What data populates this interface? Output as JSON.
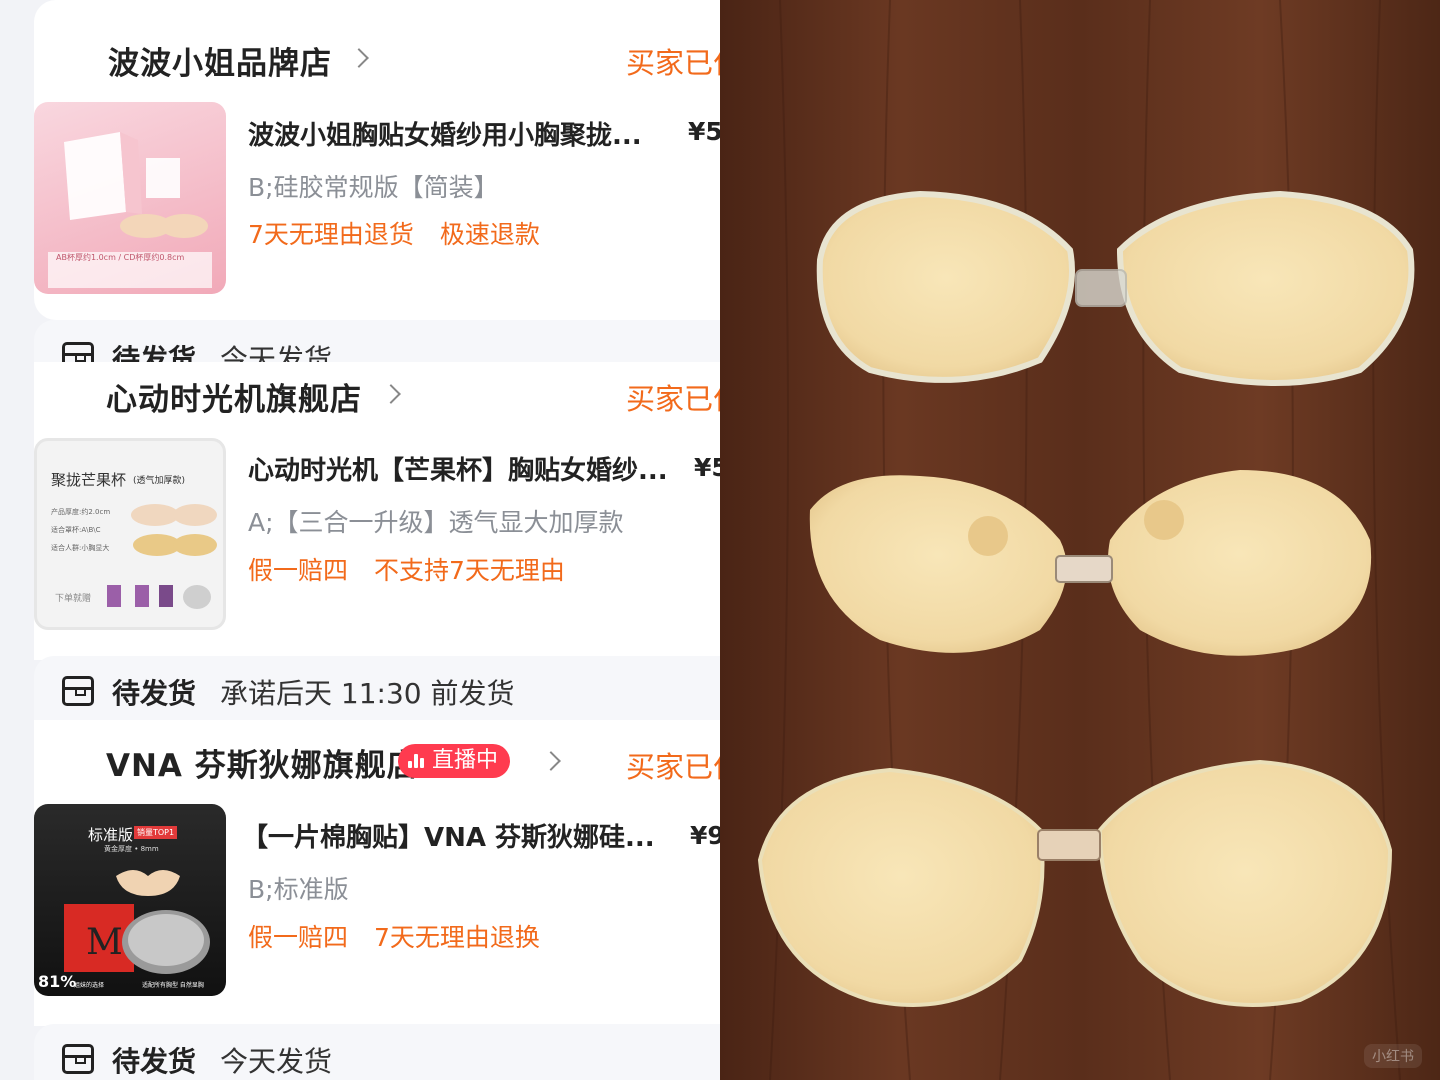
{
  "shops": [
    {
      "name": "波波小姐品牌店",
      "status": "买家已付款",
      "product_title": "波波小姐胸贴女婚纱用小胸聚拢...",
      "price": "¥5",
      "variant": "B;硅胶常规版【简装】",
      "tags": [
        "7天无理由退货",
        "极速退款"
      ],
      "thumb_text": "AB杯厚约1.0cm / CD杯厚约0.8cm",
      "strip_status": "待发货",
      "strip_ship": "今天发货"
    },
    {
      "name": "心动时光机旗舰店",
      "status": "买家已付款",
      "product_title": "心动时光机【芒果杯】胸贴女婚纱...",
      "price": "¥5",
      "variant": "A;【三合一升级】透气显大加厚款",
      "tags": [
        "假一赔四",
        "不支持7天无理由"
      ],
      "thumb_title": "聚拢芒果杯",
      "thumb_subtitle": "(透气加厚款)",
      "thumb_lines": [
        "产品厚度:约2.0cm",
        "适合罩杯:A\\B\\C",
        "适合人群:小胸显大"
      ],
      "thumb_footer": "下单就赠",
      "strip_status": "待发货",
      "strip_ship": "承诺后天 11:30 前发货"
    },
    {
      "name": "VNA 芬斯狄娜旗舰店",
      "live_label": "直播中",
      "status": "买家已付款",
      "product_title": "【一片棉胸贴】VNA 芬斯狄娜硅...",
      "price": "¥9",
      "variant": "B;标准版",
      "tags": [
        "假一赔四",
        "7天无理由退换"
      ],
      "thumb_label": "标准版",
      "thumb_badge": "销量TOP1",
      "thumb_sub": "黄金厚度 • 8mm",
      "thumb_pct": "81%",
      "thumb_pct_note": "姐妹的选择",
      "thumb_note2": "适配所有胸型 自然显胸",
      "strip_status": "待发货",
      "strip_ship": "今天发货"
    }
  ],
  "colors": {
    "accent": "#f26a1b",
    "live": "#ff3b4f",
    "wood": "#5b2f1c",
    "silicone": "#f3dfac"
  },
  "photo": {
    "items": [
      "round-silicone-bra",
      "mango-shaped-silicone-bra",
      "heart-shaped-silicone-bra"
    ],
    "watermark": "小红书"
  }
}
